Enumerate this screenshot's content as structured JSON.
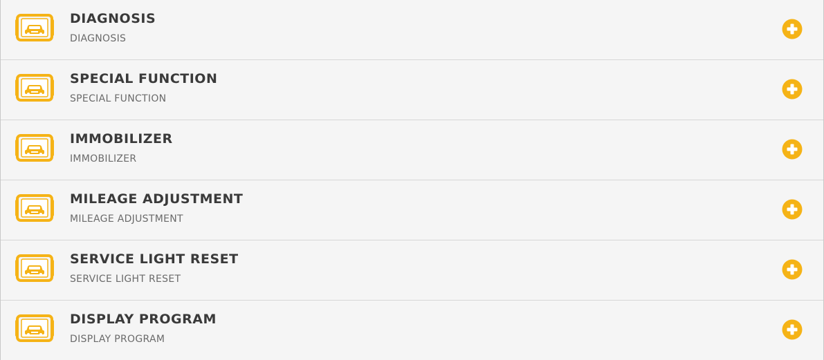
{
  "accent_color": "#f5b316",
  "items": [
    {
      "title": "DIAGNOSIS",
      "subtitle": "DIAGNOSIS",
      "icon": "car-device-icon",
      "action_icon": "plus-circle-icon"
    },
    {
      "title": "SPECIAL FUNCTION",
      "subtitle": "SPECIAL FUNCTION",
      "icon": "car-device-icon",
      "action_icon": "plus-circle-icon"
    },
    {
      "title": "IMMOBILIZER",
      "subtitle": "IMMOBILIZER",
      "icon": "car-device-icon",
      "action_icon": "plus-circle-icon"
    },
    {
      "title": "MILEAGE ADJUSTMENT",
      "subtitle": "MILEAGE ADJUSTMENT",
      "icon": "car-device-icon",
      "action_icon": "plus-circle-icon"
    },
    {
      "title": "SERVICE LIGHT RESET",
      "subtitle": "SERVICE LIGHT RESET",
      "icon": "car-device-icon",
      "action_icon": "plus-circle-icon"
    },
    {
      "title": "DISPLAY PROGRAM",
      "subtitle": "DISPLAY PROGRAM",
      "icon": "car-device-icon",
      "action_icon": "plus-circle-icon"
    }
  ]
}
